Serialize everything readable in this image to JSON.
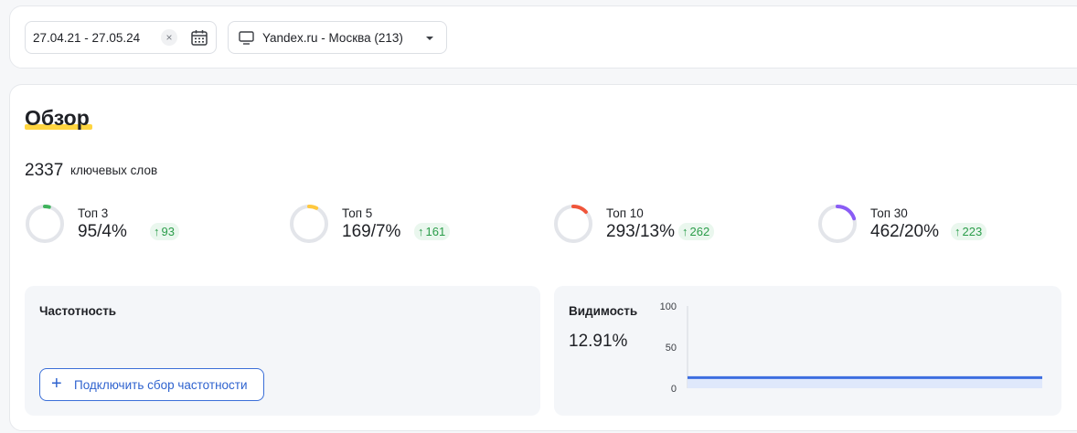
{
  "filters": {
    "date_range": "27.04.21 - 27.05.24",
    "clear_symbol": "×",
    "site_region": "Yandex.ru - Москва (213)"
  },
  "overview": {
    "title": "Обзор",
    "keyword_count": "2337",
    "keyword_label": "ключевых слов",
    "metrics": [
      {
        "label": "Топ 3",
        "value": "95/4%",
        "delta": "93",
        "percent": 4,
        "color": "#3fb35c"
      },
      {
        "label": "Топ 5",
        "value": "169/7%",
        "delta": "161",
        "percent": 7,
        "color": "#ffc83d"
      },
      {
        "label": "Топ 10",
        "value": "293/13%",
        "delta": "262",
        "percent": 13,
        "color": "#f0553a"
      },
      {
        "label": "Топ 30",
        "value": "462/20%",
        "delta": "223",
        "percent": 20,
        "color": "#8a5cf5"
      }
    ],
    "frequency": {
      "title": "Частотность",
      "connect_button": "Подключить сбор частотности"
    },
    "visibility": {
      "title": "Видимость",
      "value": "12.91%",
      "chart_data": {
        "type": "area",
        "series": [
          {
            "values": [
              12.91,
              12.91,
              12.91,
              12.91,
              12.91,
              12.91,
              12.91,
              12.91,
              12.91,
              12.91
            ]
          }
        ],
        "ylim": [
          0,
          100
        ],
        "yticks": [
          "100",
          "50",
          "0"
        ],
        "color": "#3d6ee0"
      }
    }
  }
}
